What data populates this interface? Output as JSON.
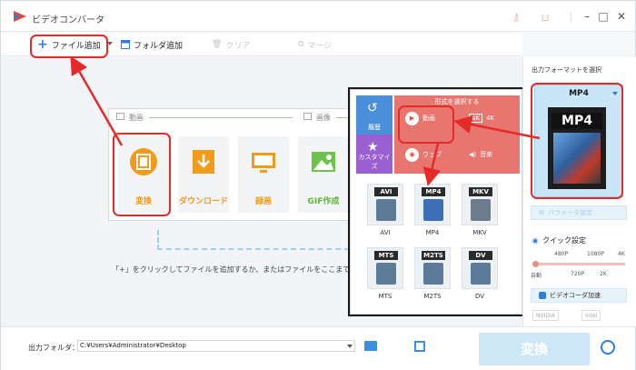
{
  "window": {
    "title": "ビデオコンバータ",
    "icons": [
      "key-icon",
      "cart-icon",
      "minimize-icon",
      "maximize-icon",
      "close-icon"
    ]
  },
  "toolbar": {
    "add_file_label": "ファイル追加",
    "add_folder_label": "フォルダ追加",
    "clear_label": "クリア",
    "merge_label": "マージ"
  },
  "main": {
    "section_video": "動画",
    "section_image": "画像",
    "functions": [
      {
        "label": "変換",
        "icon": "film-icon"
      },
      {
        "label": "ダウンロード",
        "icon": "download-icon"
      },
      {
        "label": "録画",
        "icon": "screen-record-icon"
      },
      {
        "label": "GIF作成",
        "icon": "gif-image-icon"
      }
    ],
    "hint": "「+」をクリックしてファイルを追加するか、またはファイルをここまで"
  },
  "popup": {
    "header": "形式を選択する",
    "left_tabs": [
      "履歴",
      "カスタマイズ"
    ],
    "categories": [
      "動画",
      "4K",
      "ウェブ",
      "音楽"
    ],
    "formats": [
      "AVI",
      "MP4",
      "MKV",
      "MTS",
      "M2TS",
      "DV"
    ]
  },
  "right_panel": {
    "title": "出力フォーマットを選択",
    "selected_format": "MP4",
    "box_label": "MP4",
    "param_button": "パラメータ設定",
    "quick_setting": "クイック設定",
    "slider_top_labels": [
      "480P",
      "1080P",
      "4K"
    ],
    "slider_bottom_labels": [
      "自動",
      "720P",
      "2K"
    ],
    "slider_position": 0,
    "accel_button": "ビデオコーダ加速",
    "vendors": [
      "NVIDIA",
      "Intel"
    ]
  },
  "bottom": {
    "output_folder_label": "出力フォルダ：",
    "output_path": "C:¥Users¥Administrator¥Desktop",
    "convert_label": "変換"
  },
  "colors": {
    "accent": "#2f7de1",
    "annotation": "#e52a2a",
    "function_orange": "#f29a1a",
    "popup_red": "#e87670"
  }
}
